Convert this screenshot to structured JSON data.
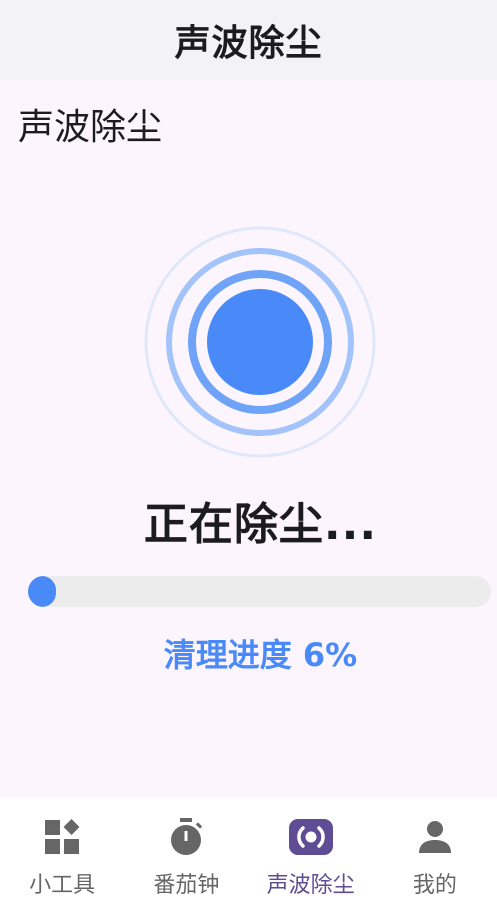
{
  "app_bar": {
    "title": "声波除尘"
  },
  "page": {
    "heading": "声波除尘",
    "status_text": "正在除尘...",
    "progress": {
      "label": "清理进度 6%",
      "percent": 6
    }
  },
  "colors": {
    "accent_blue": "#4a8af8",
    "active_nav": "#5e4d94"
  },
  "bottom_nav": {
    "items": [
      {
        "label": "小工具",
        "icon": "widgets-icon",
        "active": false
      },
      {
        "label": "番茄钟",
        "icon": "timer-icon",
        "active": false
      },
      {
        "label": "声波除尘",
        "icon": "sonic-wave-icon",
        "active": true
      },
      {
        "label": "我的",
        "icon": "person-icon",
        "active": false
      }
    ]
  }
}
